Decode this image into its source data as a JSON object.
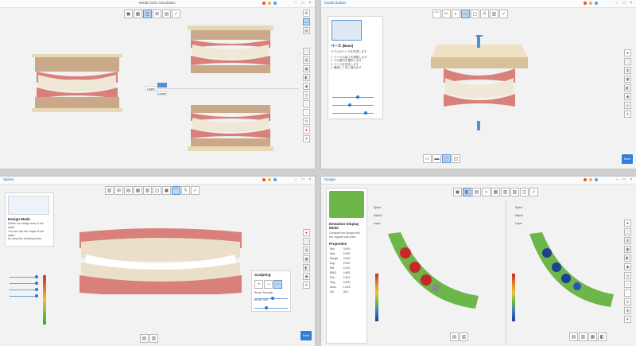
{
  "q1": {
    "title": "Medit Ortho Simulation",
    "label_upper": "Upper",
    "label_lower": "Lower"
  },
  "q2": {
    "app_name": "Model Builder",
    "panel_heading": "ベース (Base)",
    "panel_lines": [
      "モデルのベースを作成します",
      "1. ベースの高さを調整します",
      "2. 下の歯列を選択します",
      "3. ベースを作成します",
      "4. 確認して次に進みます"
    ],
    "next_label": "Next"
  },
  "q3": {
    "app_name": "Splints",
    "title": "Medit Splints",
    "mode_heading": "Design Mode",
    "mode_text": [
      "Define the design area of the splint.",
      "You can edit the shape of the splint",
      "by using the sculpting tools."
    ],
    "sculpt_heading": "Sculpting",
    "sculpt_labels": [
      "Brush Strength",
      "Brush Size"
    ],
    "next_label": "Next"
  },
  "q4": {
    "app_name": "Design",
    "deviation_heading": "Deviation Display Mode",
    "deviation_text": "Compare the design with the original scan data.",
    "properties_heading": "Properties",
    "properties_rows": [
      [
        "Min",
        "0.000"
      ],
      [
        "Max",
        "2.000"
      ],
      [
        "Range",
        "2.000"
      ],
      [
        "Avg",
        "0.541"
      ],
      [
        "Std",
        "0.212"
      ],
      [
        "RMS",
        "0.583"
      ],
      [
        "Pos",
        "0.541"
      ],
      [
        "Neg",
        "0.000"
      ],
      [
        "Area",
        "1,024"
      ],
      [
        "Vol",
        "96.2"
      ]
    ],
    "tree_left": [
      "Splint",
      "Adjust",
      "Layer"
    ],
    "tree_right": [
      "Splint",
      "Adjust",
      "Layer"
    ]
  }
}
